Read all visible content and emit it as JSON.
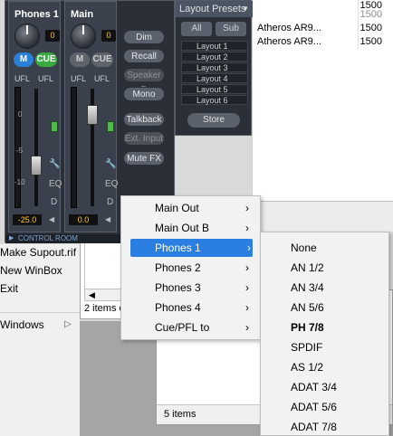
{
  "bg_table": {
    "rows": [
      {
        "name": "",
        "value": "1500",
        "gray": false
      },
      {
        "name": "",
        "value": "1500",
        "gray": true
      },
      {
        "name": "Atheros AR9...",
        "value": "1500",
        "gray": false
      },
      {
        "name": "Atheros AR9...",
        "value": "1500",
        "gray": false
      }
    ]
  },
  "left_menu": {
    "items": [
      {
        "label": "Make Supout.rif"
      },
      {
        "label": "New WinBox"
      },
      {
        "label": "Exit"
      },
      {
        "label": "Windows"
      }
    ],
    "windows_arrow": "▷"
  },
  "dialog": {
    "status": "2 items o",
    "scroll_left": "◀"
  },
  "lower_window": {
    "status": "5 items"
  },
  "mixer": {
    "strips": [
      {
        "title": "Phones 1",
        "gain": "0",
        "m": "M",
        "cue": "CUE",
        "m_on": true,
        "cue_on": true,
        "ufl_a": "UFL",
        "ufl_b": "UFL",
        "volume": "-25.0"
      },
      {
        "title": "Main",
        "gain": "0",
        "m": "M",
        "cue": "CUE",
        "m_on": false,
        "cue_on": false,
        "ufl_a": "UFL",
        "ufl_b": "UFL",
        "volume": "0.0"
      }
    ],
    "level_marks": [
      "0",
      "-5",
      "-10"
    ],
    "eq_label": "EQ",
    "d_label": "D",
    "side_buttons": [
      {
        "label": "Dim",
        "enabled": true
      },
      {
        "label": "Recall",
        "enabled": true
      },
      {
        "label": "Speaker B",
        "enabled": false
      },
      {
        "label": "Mono",
        "enabled": true
      },
      {
        "label": "Talkback",
        "enabled": true
      },
      {
        "label": "Ext. Input",
        "enabled": false
      },
      {
        "label": "Mute FX",
        "enabled": true
      }
    ],
    "control_room_label": "CONTROL ROOM",
    "control_room_arrow": "▶"
  },
  "presets": {
    "title": "Layout Presets",
    "tabs": [
      "All",
      "Sub"
    ],
    "items": [
      "Layout 1",
      "Layout 2",
      "Layout 3",
      "Layout 4",
      "Layout 5",
      "Layout 6"
    ],
    "store": "Store"
  },
  "context_menu": {
    "items": [
      {
        "label": "Main Out",
        "highlighted": false
      },
      {
        "label": "Main Out B",
        "highlighted": false
      },
      {
        "label": "Phones 1",
        "highlighted": true
      },
      {
        "label": "Phones 2",
        "highlighted": false
      },
      {
        "label": "Phones 3",
        "highlighted": false
      },
      {
        "label": "Phones 4",
        "highlighted": false
      },
      {
        "label": "Cue/PFL to",
        "highlighted": false
      }
    ],
    "chevron": "›"
  },
  "submenu": {
    "items": [
      {
        "label": "None",
        "selected": false
      },
      {
        "label": "AN 1/2",
        "selected": false
      },
      {
        "label": "AN 3/4",
        "selected": false
      },
      {
        "label": "AN 5/6",
        "selected": false
      },
      {
        "label": "PH 7/8",
        "selected": true
      },
      {
        "label": "SPDIF",
        "selected": false
      },
      {
        "label": "AS 1/2",
        "selected": false
      },
      {
        "label": "ADAT 3/4",
        "selected": false
      },
      {
        "label": "ADAT 5/6",
        "selected": false
      },
      {
        "label": "ADAT 7/8",
        "selected": false
      }
    ]
  },
  "colors": {
    "highlight": "#2b7fe0",
    "mute_on": "#2a7fd6",
    "cue_on": "#3aa843",
    "readout_text": "#ffc62c"
  }
}
